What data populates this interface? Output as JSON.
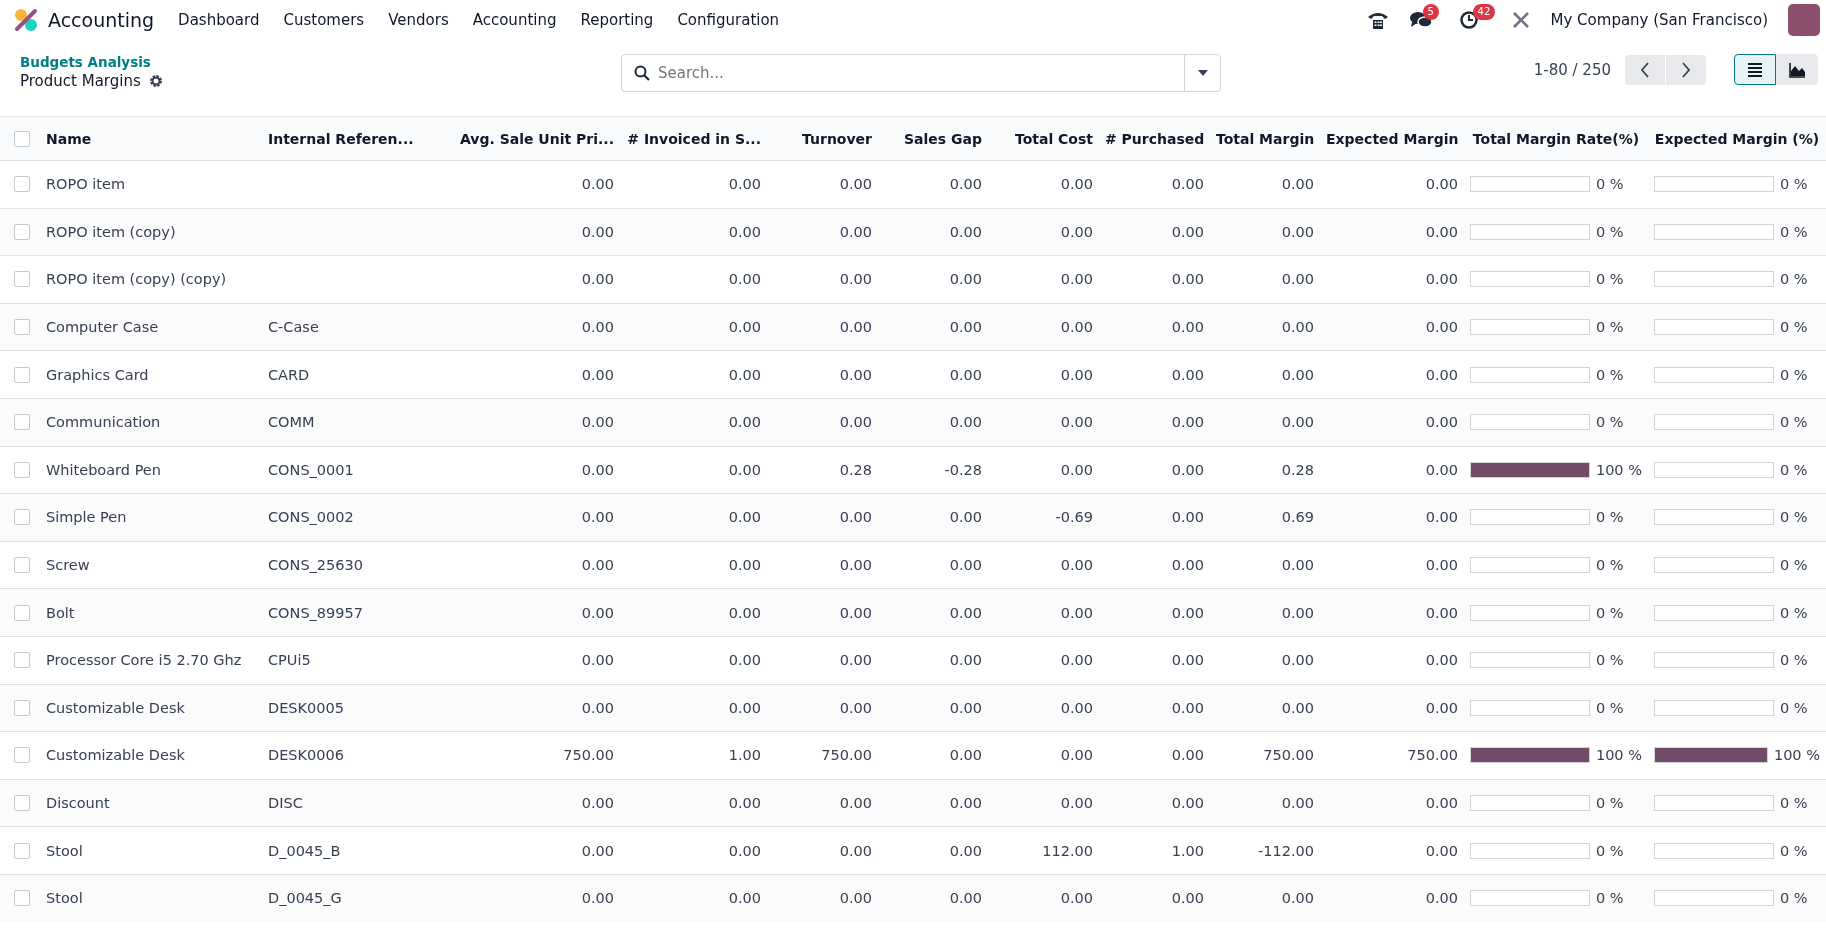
{
  "navbar": {
    "app": "Accounting",
    "menu": [
      "Dashboard",
      "Customers",
      "Vendors",
      "Accounting",
      "Reporting",
      "Configuration"
    ],
    "messages_badge": "5",
    "activities_badge": "42",
    "company": "My Company (San Francisco)"
  },
  "breadcrumb": {
    "parent": "Budgets Analysis",
    "current": "Product Margins"
  },
  "search": {
    "placeholder": "Search..."
  },
  "pager": {
    "range": "1-80 / 250"
  },
  "views": [
    {
      "kind": "list",
      "selected": true
    },
    {
      "kind": "graph",
      "selected": false
    }
  ],
  "table": {
    "select_all": {
      "checked": false
    },
    "columns": [
      "Name",
      "Internal Referen...",
      "Avg. Sale Unit Pri...",
      "# Invoiced in S...",
      "Turnover",
      "Sales Gap",
      "Total Cost",
      "# Purchased",
      "Total Margin",
      "Expected Margin",
      "Total Margin Rate(%)",
      "Expected Margin (%)"
    ],
    "rows": [
      {
        "checked": false,
        "name": "ROPO item",
        "ref": "",
        "values": [
          "0.00",
          "0.00",
          "0.00",
          "0.00",
          "0.00",
          "0.00",
          "0.00",
          "0.00"
        ],
        "rate": {
          "level": 0,
          "text": "0 %"
        },
        "expected_rate": {
          "level": 0,
          "text": "0 %"
        }
      },
      {
        "checked": false,
        "name": "ROPO item (copy)",
        "ref": "",
        "values": [
          "0.00",
          "0.00",
          "0.00",
          "0.00",
          "0.00",
          "0.00",
          "0.00",
          "0.00"
        ],
        "rate": {
          "level": 0,
          "text": "0 %"
        },
        "expected_rate": {
          "level": 0,
          "text": "0 %"
        }
      },
      {
        "checked": false,
        "name": "ROPO item (copy) (copy)",
        "ref": "",
        "values": [
          "0.00",
          "0.00",
          "0.00",
          "0.00",
          "0.00",
          "0.00",
          "0.00",
          "0.00"
        ],
        "rate": {
          "level": 0,
          "text": "0 %"
        },
        "expected_rate": {
          "level": 0,
          "text": "0 %"
        }
      },
      {
        "checked": false,
        "name": "Computer Case",
        "ref": "C-Case",
        "values": [
          "0.00",
          "0.00",
          "0.00",
          "0.00",
          "0.00",
          "0.00",
          "0.00",
          "0.00"
        ],
        "rate": {
          "level": 0,
          "text": "0 %"
        },
        "expected_rate": {
          "level": 0,
          "text": "0 %"
        }
      },
      {
        "checked": false,
        "name": "Graphics Card",
        "ref": "CARD",
        "values": [
          "0.00",
          "0.00",
          "0.00",
          "0.00",
          "0.00",
          "0.00",
          "0.00",
          "0.00"
        ],
        "rate": {
          "level": 0,
          "text": "0 %"
        },
        "expected_rate": {
          "level": 0,
          "text": "0 %"
        }
      },
      {
        "checked": false,
        "name": "Communication",
        "ref": "COMM",
        "values": [
          "0.00",
          "0.00",
          "0.00",
          "0.00",
          "0.00",
          "0.00",
          "0.00",
          "0.00"
        ],
        "rate": {
          "level": 0,
          "text": "0 %"
        },
        "expected_rate": {
          "level": 0,
          "text": "0 %"
        }
      },
      {
        "checked": false,
        "name": "Whiteboard Pen",
        "ref": "CONS_0001",
        "values": [
          "0.00",
          "0.00",
          "0.28",
          "-0.28",
          "0.00",
          "0.00",
          "0.28",
          "0.00"
        ],
        "rate": {
          "level": 1,
          "text": "100 %"
        },
        "expected_rate": {
          "level": 0,
          "text": "0 %"
        }
      },
      {
        "checked": false,
        "name": "Simple Pen",
        "ref": "CONS_0002",
        "values": [
          "0.00",
          "0.00",
          "0.00",
          "0.00",
          "-0.69",
          "0.00",
          "0.69",
          "0.00"
        ],
        "rate": {
          "level": 0,
          "text": "0 %"
        },
        "expected_rate": {
          "level": 0,
          "text": "0 %"
        }
      },
      {
        "checked": false,
        "name": "Screw",
        "ref": "CONS_25630",
        "values": [
          "0.00",
          "0.00",
          "0.00",
          "0.00",
          "0.00",
          "0.00",
          "0.00",
          "0.00"
        ],
        "rate": {
          "level": 0,
          "text": "0 %"
        },
        "expected_rate": {
          "level": 0,
          "text": "0 %"
        }
      },
      {
        "checked": false,
        "name": "Bolt",
        "ref": "CONS_89957",
        "values": [
          "0.00",
          "0.00",
          "0.00",
          "0.00",
          "0.00",
          "0.00",
          "0.00",
          "0.00"
        ],
        "rate": {
          "level": 0,
          "text": "0 %"
        },
        "expected_rate": {
          "level": 0,
          "text": "0 %"
        }
      },
      {
        "checked": false,
        "name": "Processor Core i5 2.70 Ghz",
        "ref": "CPUi5",
        "values": [
          "0.00",
          "0.00",
          "0.00",
          "0.00",
          "0.00",
          "0.00",
          "0.00",
          "0.00"
        ],
        "rate": {
          "level": 0,
          "text": "0 %"
        },
        "expected_rate": {
          "level": 0,
          "text": "0 %"
        }
      },
      {
        "checked": false,
        "name": "Customizable Desk",
        "ref": "DESK0005",
        "values": [
          "0.00",
          "0.00",
          "0.00",
          "0.00",
          "0.00",
          "0.00",
          "0.00",
          "0.00"
        ],
        "rate": {
          "level": 0,
          "text": "0 %"
        },
        "expected_rate": {
          "level": 0,
          "text": "0 %"
        }
      },
      {
        "checked": false,
        "name": "Customizable Desk",
        "ref": "DESK0006",
        "values": [
          "750.00",
          "1.00",
          "750.00",
          "0.00",
          "0.00",
          "0.00",
          "750.00",
          "750.00"
        ],
        "rate": {
          "level": 1,
          "text": "100 %"
        },
        "expected_rate": {
          "level": 1,
          "text": "100 %"
        }
      },
      {
        "checked": false,
        "name": "Discount",
        "ref": "DISC",
        "values": [
          "0.00",
          "0.00",
          "0.00",
          "0.00",
          "0.00",
          "0.00",
          "0.00",
          "0.00"
        ],
        "rate": {
          "level": 0,
          "text": "0 %"
        },
        "expected_rate": {
          "level": 0,
          "text": "0 %"
        }
      },
      {
        "checked": false,
        "name": "Stool",
        "ref": "D_0045_B",
        "values": [
          "0.00",
          "0.00",
          "0.00",
          "0.00",
          "112.00",
          "1.00",
          "-112.00",
          "0.00"
        ],
        "rate": {
          "level": 0,
          "text": "0 %"
        },
        "expected_rate": {
          "level": 0,
          "text": "0 %"
        }
      },
      {
        "checked": false,
        "name": "Stool",
        "ref": "D_0045_G",
        "values": [
          "0.00",
          "0.00",
          "0.00",
          "0.00",
          "0.00",
          "0.00",
          "0.00",
          "0.00"
        ],
        "rate": {
          "level": 0,
          "text": "0 %"
        },
        "expected_rate": {
          "level": 0,
          "text": "0 %"
        }
      }
    ]
  }
}
